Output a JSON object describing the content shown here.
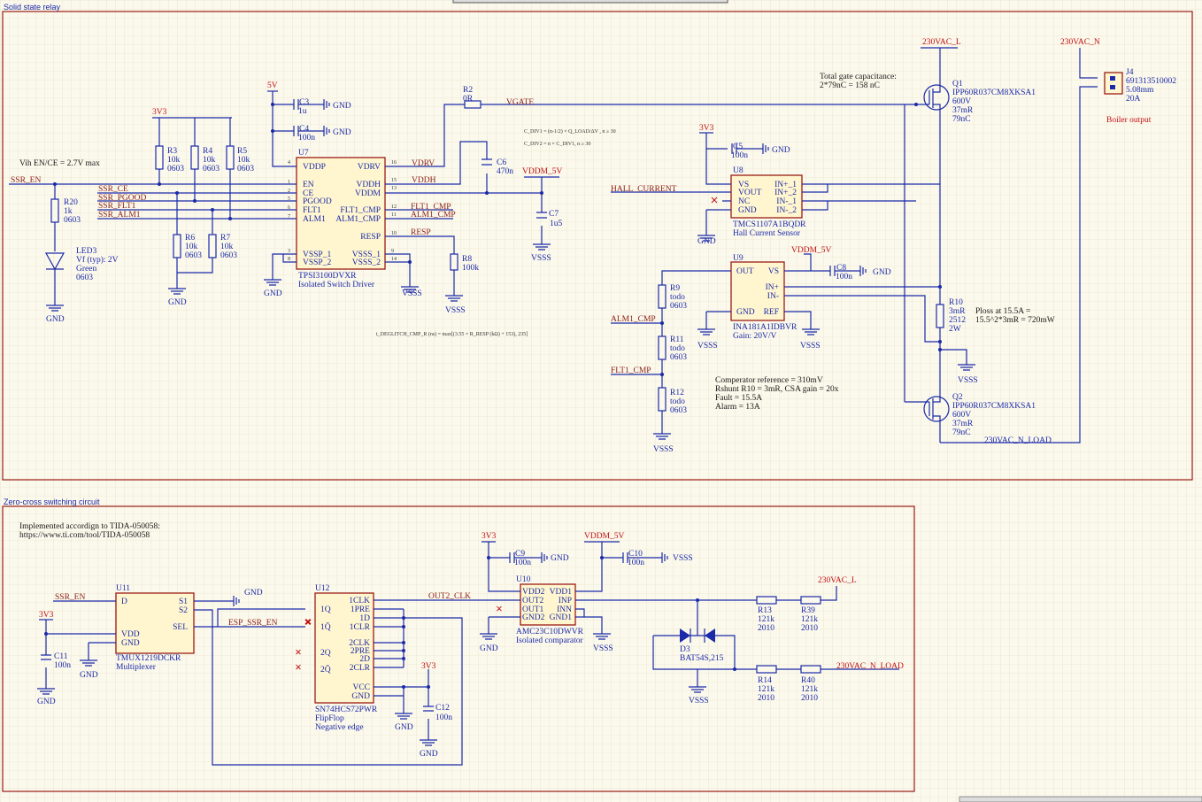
{
  "sections": {
    "ssr": "Solid state relay",
    "zc": "Zero-cross switching circuit"
  },
  "notes": {
    "vih": "Vih EN/CE = 2.7V max",
    "gate_cap_1": "Total gate capacitance:",
    "gate_cap_2": "2*79nC = 158 nC",
    "comp_ref": "Comperator reference = 310mV",
    "rshunt": "Rshunt R10 = 3mR, CSA gain = 20x",
    "fault": "Fault = 15.5A",
    "alarm": "Alarm = 13A",
    "ploss_1": "Ploss at 15.5A =",
    "ploss_2": "15.5^2*3mR = 720mW",
    "tida_1": "Implemented accordign to TIDA-050058:",
    "tida_2": "https://www.ti.com/tool/TIDA-050058",
    "boiler": "Boiler output",
    "formula1": "C_DIV1 = (n-1/2) × Q_LOAD/ΔV , n ≥ 30",
    "formula2": "C_DIV2 = n × C_DIV1, n ≥ 30",
    "formula3": "t_DEGLITCH_CMP_R (ns) = max[(3.55 × R_RESP (kΩ) + 153), 235]"
  },
  "nets": {
    "ssr_en": "SSR_EN",
    "ssr_ce": "SSR_CE",
    "ssr_pgood": "SSR_PGOOD",
    "ssr_flt1": "SSR_FLT1",
    "ssr_alm1": "SSR_ALM1",
    "vgate": "VGATE",
    "vdrv": "VDRV",
    "vddh": "VDDH",
    "flt1_cmp": "FLT1_CMP",
    "alm1_cmp": "ALM1_CMP",
    "resp": "RESP",
    "hall": "HALL_CURRENT",
    "vddm": "VDDM_5V",
    "l": "230VAC_L",
    "n": "230VAC_N",
    "nload": "230VAC_N_LOAD",
    "out2": "OUT2_CLK",
    "esp": "ESP_SSR_EN",
    "gnd": "GND",
    "vsss": "VSSS",
    "v3v3": "3V3",
    "v5": "5V"
  },
  "u7": {
    "ref": "U7",
    "part": "TPSI3100DVXR",
    "desc": "Isolated Switch Driver",
    "left": [
      "VDDP",
      "EN",
      "CE",
      "PGOOD",
      "FLT1",
      "ALM1",
      "VSSP_1",
      "VSSP_2"
    ],
    "right": [
      "VDRV",
      "VDDH",
      "VDDM",
      "FLT1_CMP",
      "ALM1_CMP",
      "RESP",
      "VSSS_1",
      "VSSS_2"
    ]
  },
  "u8": {
    "ref": "U8",
    "part": "TMCS1107A1BQDR",
    "desc": "Hall Current Sensor",
    "left": [
      "VS",
      "VOUT",
      "NC",
      "GND"
    ],
    "right": [
      "IN+_1",
      "IN+_2",
      "IN-_1",
      "IN-_2"
    ]
  },
  "u9": {
    "ref": "U9",
    "part": "INA181A1IDBVR",
    "desc": "Gain: 20V/V",
    "left": [
      "OUT",
      "GND"
    ],
    "right": [
      "VS",
      "IN+",
      "IN-",
      "REF"
    ]
  },
  "u10": {
    "ref": "U10",
    "part": "AMC23C10DWVR",
    "desc": "Isolated comparator",
    "left": [
      "VDD2",
      "OUT2",
      "OUT1",
      "GND2"
    ],
    "right": [
      "VDD1",
      "INP",
      "INN",
      "GND1"
    ]
  },
  "u11": {
    "ref": "U11",
    "part": "TMUX1219DCKR",
    "desc": "Multiplexer",
    "left": [
      "D",
      "VDD",
      "GND"
    ],
    "right": [
      "S1",
      "S2",
      "SEL"
    ]
  },
  "u12": {
    "ref": "U12",
    "part": "SN74HCS72PWR",
    "desc1": "FlipFlop",
    "desc2": "Negative edge",
    "left": [
      "1Q",
      "1Q̄",
      "2Q",
      "2Q̄"
    ],
    "right": [
      "1CLK",
      "1PRE",
      "1D",
      "1CLR",
      "2CLK",
      "2PRE",
      "2D",
      "2CLR",
      "VCC",
      "GND"
    ]
  },
  "j4": {
    "ref": "J4",
    "part": "691313510002",
    "pitch": "5.08mm",
    "rating": "20A"
  },
  "q1": {
    "ref": "Q1",
    "part": "IPP60R037CM8XKSA1",
    "v": "600V",
    "r": "37mR",
    "q": "79nC"
  },
  "q2": {
    "ref": "Q2",
    "part": "IPP60R037CM8XKSA1",
    "v": "600V",
    "r": "37mR",
    "q": "79nC"
  },
  "passives": {
    "c3": [
      "C3",
      "1u"
    ],
    "c4": [
      "C4",
      "100n"
    ],
    "r2": [
      "R2",
      "0R"
    ],
    "c6": [
      "C6",
      "470n"
    ],
    "c7": [
      "C7",
      "1u5"
    ],
    "r3": [
      "R3",
      "10k",
      "0603"
    ],
    "r4": [
      "R4",
      "10k",
      "0603"
    ],
    "r5": [
      "R5",
      "10k",
      "0603"
    ],
    "r6": [
      "R6",
      "10k",
      "0603"
    ],
    "r7": [
      "R7",
      "10k",
      "0603"
    ],
    "r20": [
      "R20",
      "1k",
      "0603"
    ],
    "led3": [
      "LED3",
      "Vf (typ): 2V",
      "Green",
      "0603"
    ],
    "r8": [
      "R8",
      "100k"
    ],
    "c5": [
      "C5",
      "100n"
    ],
    "c8": [
      "C8",
      "100n"
    ],
    "r9": [
      "R9",
      "todo",
      "0603"
    ],
    "r11": [
      "R11",
      "todo",
      "0603"
    ],
    "r12": [
      "R12",
      "todo",
      "0603"
    ],
    "r10": [
      "R10",
      "3mR",
      "2512",
      "2W"
    ],
    "c9": [
      "C9",
      "100n"
    ],
    "c10": [
      "C10",
      "100n"
    ],
    "c11": [
      "C11",
      "100n"
    ],
    "c12": [
      "C12",
      "100n"
    ],
    "r13": [
      "R13",
      "121k",
      "2010"
    ],
    "r39": [
      "R39",
      "121k",
      "2010"
    ],
    "r14": [
      "R14",
      "121k",
      "2010"
    ],
    "r40": [
      "R40",
      "121k",
      "2010"
    ],
    "d3": [
      "D3",
      "BAT54S,215"
    ]
  }
}
